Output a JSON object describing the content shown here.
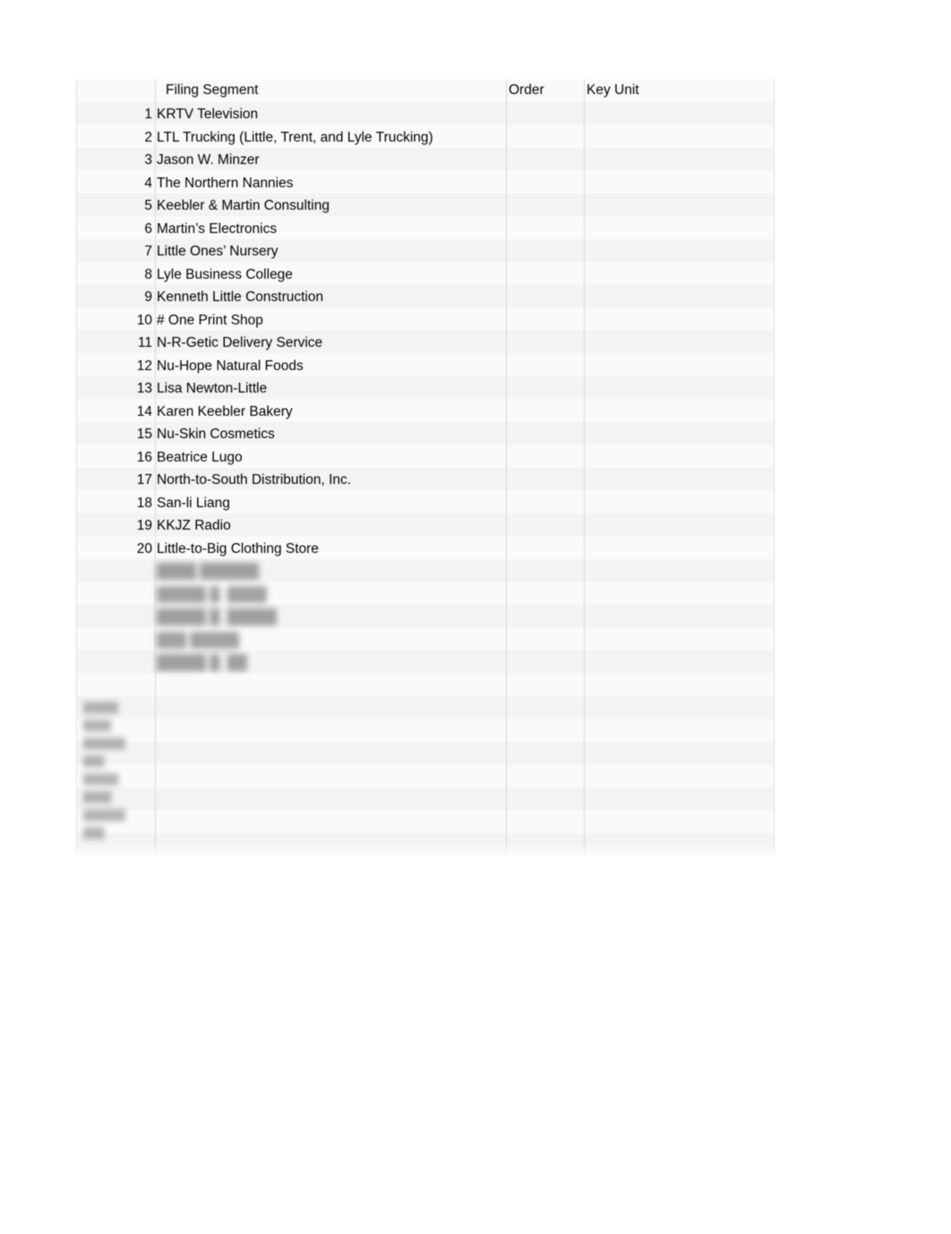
{
  "document": {
    "title": "Filing Segment Worksheet",
    "sheet_background": "#ffffff",
    "row_band_light": "#fafafa",
    "row_band_dark": "#f3f3f3",
    "rule_color": "#d8d8d8",
    "text_color": "#000000"
  },
  "table": {
    "columns": [
      {
        "key": "number",
        "label": ""
      },
      {
        "key": "segment",
        "label": "Filing Segment"
      },
      {
        "key": "order",
        "label": "Order"
      },
      {
        "key": "key_unit",
        "label": "Key Unit"
      }
    ],
    "rows": [
      {
        "number": "1",
        "segment": "KRTV Television",
        "order": "",
        "key_unit": ""
      },
      {
        "number": "2",
        "segment": "LTL Trucking (Little, Trent, and Lyle Trucking)",
        "order": "",
        "key_unit": ""
      },
      {
        "number": "3",
        "segment": "Jason W. Minzer",
        "order": "",
        "key_unit": ""
      },
      {
        "number": "4",
        "segment": "The Northern Nannies",
        "order": "",
        "key_unit": ""
      },
      {
        "number": "5",
        "segment": "Keebler & Martin Consulting",
        "order": "",
        "key_unit": ""
      },
      {
        "number": "6",
        "segment": "Martin’s Electronics",
        "order": "",
        "key_unit": ""
      },
      {
        "number": "7",
        "segment": "Little Ones’ Nursery",
        "order": "",
        "key_unit": ""
      },
      {
        "number": "8",
        "segment": "Lyle Business College",
        "order": "",
        "key_unit": ""
      },
      {
        "number": "9",
        "segment": "Kenneth Little Construction",
        "order": "",
        "key_unit": ""
      },
      {
        "number": "10",
        "segment": "# One Print Shop",
        "order": "",
        "key_unit": ""
      },
      {
        "number": "11",
        "segment": "N-R-Getic Delivery Service",
        "order": "",
        "key_unit": ""
      },
      {
        "number": "12",
        "segment": "Nu-Hope Natural Foods",
        "order": "",
        "key_unit": ""
      },
      {
        "number": "13",
        "segment": "Lisa Newton-Little",
        "order": "",
        "key_unit": ""
      },
      {
        "number": "14",
        "segment": "Karen Keebler Bakery",
        "order": "",
        "key_unit": ""
      },
      {
        "number": "15",
        "segment": "Nu-Skin Cosmetics",
        "order": "",
        "key_unit": ""
      },
      {
        "number": "16",
        "segment": "Beatrice Lugo",
        "order": "",
        "key_unit": ""
      },
      {
        "number": "17",
        "segment": "North-to-South Distribution, Inc.",
        "order": "",
        "key_unit": ""
      },
      {
        "number": "18",
        "segment": "San-li Liang",
        "order": "",
        "key_unit": ""
      },
      {
        "number": "19",
        "segment": "KKJZ Radio",
        "order": "",
        "key_unit": ""
      },
      {
        "number": "20",
        "segment": "Little-to-Big Clothing Store",
        "order": "",
        "key_unit": ""
      }
    ],
    "redacted_rows": [
      {
        "text": "████ ██████"
      },
      {
        "text": "█████ █. ████"
      },
      {
        "text": "█████ █. █████"
      },
      {
        "text": "███ █████"
      },
      {
        "text": "█████ █. ██"
      }
    ],
    "redacted_margin_notes": [
      {
        "text": "█████"
      },
      {
        "text": "████"
      },
      {
        "text": "██████"
      },
      {
        "text": "███"
      },
      {
        "text": "█████"
      },
      {
        "text": "████"
      },
      {
        "text": "██████"
      },
      {
        "text": "███"
      }
    ]
  }
}
